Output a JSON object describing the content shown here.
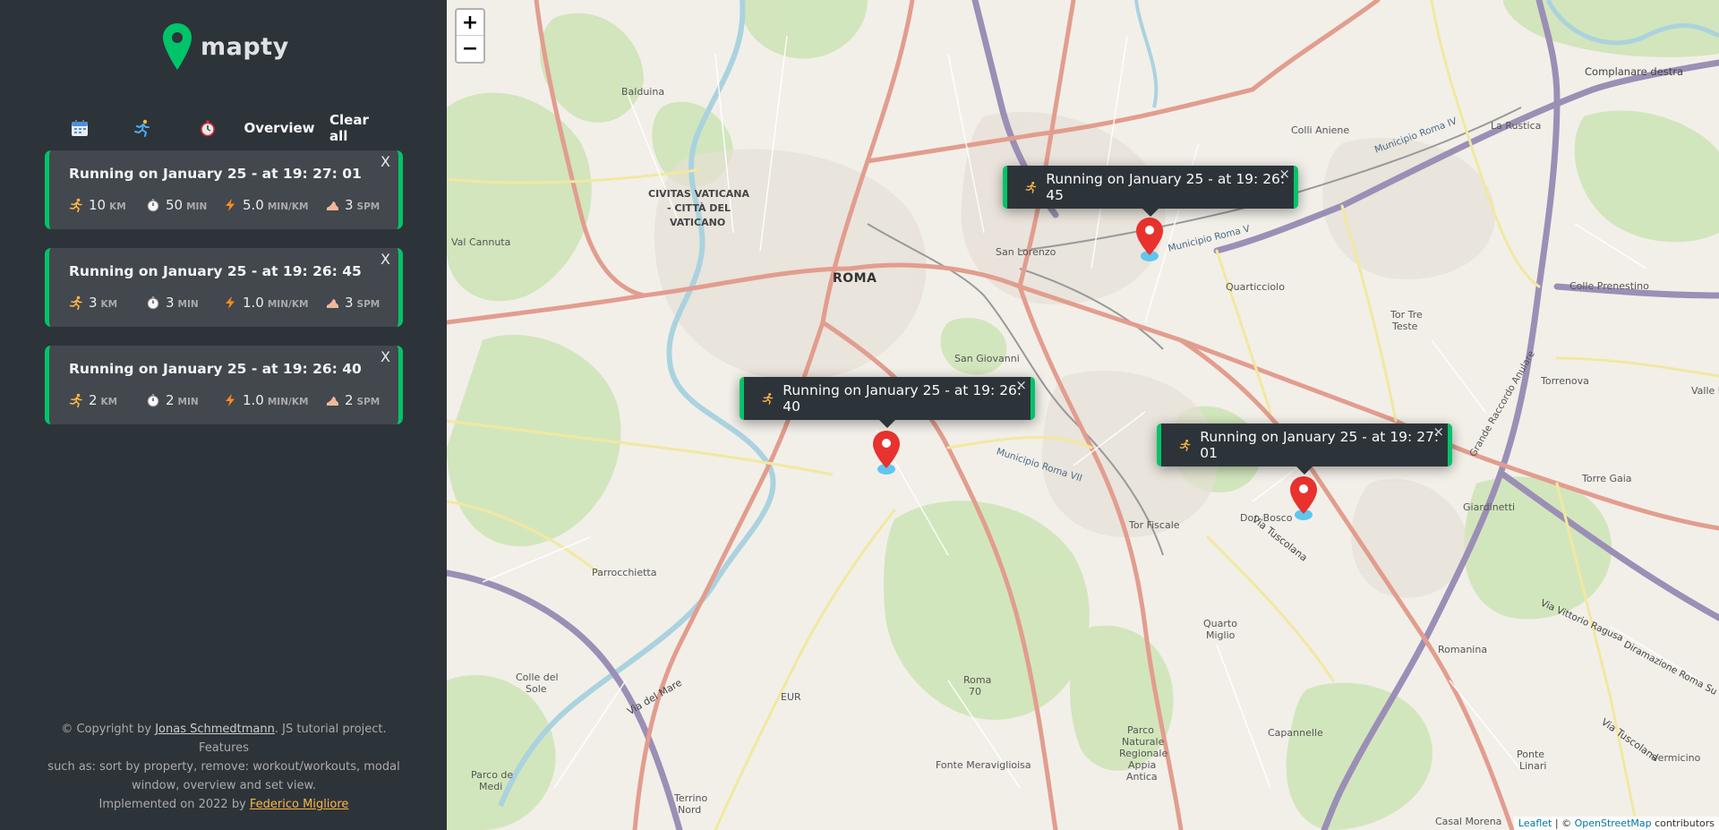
{
  "app": {
    "name": "mapty"
  },
  "toolbar": {
    "sort_date_icon": "calendar-icon",
    "sort_type_icon": "runner-icon",
    "sort_duration_icon": "stopwatch-icon",
    "overview_label": "Overview",
    "clear_label": "Clear all"
  },
  "workouts": [
    {
      "title": "Running on January 25 - at 19: 27: 01",
      "close": "X",
      "distance": "10",
      "distance_unit": "KM",
      "duration": "50",
      "duration_unit": "MIN",
      "pace": "5.0",
      "pace_unit": "MIN/KM",
      "cadence": "3",
      "cadence_unit": "SPM"
    },
    {
      "title": "Running on January 25 - at 19: 26: 45",
      "close": "X",
      "distance": "3",
      "distance_unit": "KM",
      "duration": "3",
      "duration_unit": "MIN",
      "pace": "1.0",
      "pace_unit": "MIN/KM",
      "cadence": "3",
      "cadence_unit": "SPM"
    },
    {
      "title": "Running on January 25 - at 19: 26: 40",
      "close": "X",
      "distance": "2",
      "distance_unit": "KM",
      "duration": "2",
      "duration_unit": "MIN",
      "pace": "1.0",
      "pace_unit": "MIN/KM",
      "cadence": "2",
      "cadence_unit": "SPM"
    }
  ],
  "footer": {
    "prefix": "© Copyright by ",
    "author": "Jonas Schmedtmann",
    "line1_rest": ". JS tutorial project. Features",
    "line2": "such as: sort by property, remove: workout/workouts, modal",
    "line3": "window, overview and set view.",
    "impl_prefix": "Implemented on 2022 by ",
    "implementer": "Federico Migliore"
  },
  "map": {
    "zoom_in": "+",
    "zoom_out": "−",
    "attribution_leaflet": "Leaflet",
    "attribution_sep": " | © ",
    "attribution_osm": "OpenStreetMap",
    "attribution_rest": " contributors",
    "popups": [
      {
        "text": "Running on January 25 - at 19: 26: 45",
        "close": "×"
      },
      {
        "text": "Running on January 25 - at 19: 26: 40",
        "close": "×"
      },
      {
        "text": "Running on January 25 - at 19: 27: 01",
        "close": "×"
      }
    ],
    "labels": {
      "roma": "ROMA",
      "vaticano1": "CIVITAS VATICANA",
      "vaticano2": "- CITTÀ DEL",
      "vaticano3": "VATICANO",
      "balduina": "Balduina",
      "val_cannuta": "Val Cannuta",
      "san_lorenzo": "San Lorenzo",
      "san_giovanni": "San Giovanni",
      "quarticciolo": "Quarticciolo",
      "colli_aniene": "Colli Aniene",
      "la_rustica": "La Rustica",
      "colle_prenestino": "Colle Prenestino",
      "tor_tre_teste1": "Tor Tre",
      "tor_tre_teste2": "Teste",
      "torrenova": "Torrenova",
      "torre_gaia": "Torre Gaia",
      "giardinetti": "Giardinetti",
      "don_bosco": "Don Bosco",
      "tor_fiscale": "Tor Fiscale",
      "parrocchietta": "Parrocchietta",
      "quarto_miglio1": "Quarto",
      "quarto_miglio2": "Miglio",
      "colle_del_sole1": "Colle del",
      "colle_del_sole2": "Sole",
      "eur": "EUR",
      "roma70_1": "Roma",
      "roma70_2": "70",
      "fonte": "Fonte Meraviglioisa",
      "parco1": "Parco",
      "parco2": "Naturale",
      "parco3": "Regionale",
      "parco4": "Appia",
      "parco5": "Antica",
      "capannelle": "Capannelle",
      "romanina": "Romanina",
      "ponte_linari1": "Ponte",
      "ponte_linari2": "Linari",
      "vermicino": "Vermicino",
      "casal_morena": "Casal Morena",
      "terrino1": "Terrino",
      "terrino2": "Nord",
      "parco_medi1": "Parco de",
      "parco_medi2": "Medi",
      "valle_f": "Valle F",
      "complanare": "Complanare destra",
      "via_tuscolana": "Via Tuscolana",
      "via_del_mare": "Via del Mare",
      "municipio_v": "Municipio Roma V",
      "municipio_vii": "Municipio Roma VII",
      "municipio_iv": "Municipio Roma IV",
      "grande_raccordo": "Grande Raccordo Anulare",
      "via_vittorio": "Via Vittorio Ragusa",
      "diramazione": "Diramazione Roma Su"
    }
  }
}
